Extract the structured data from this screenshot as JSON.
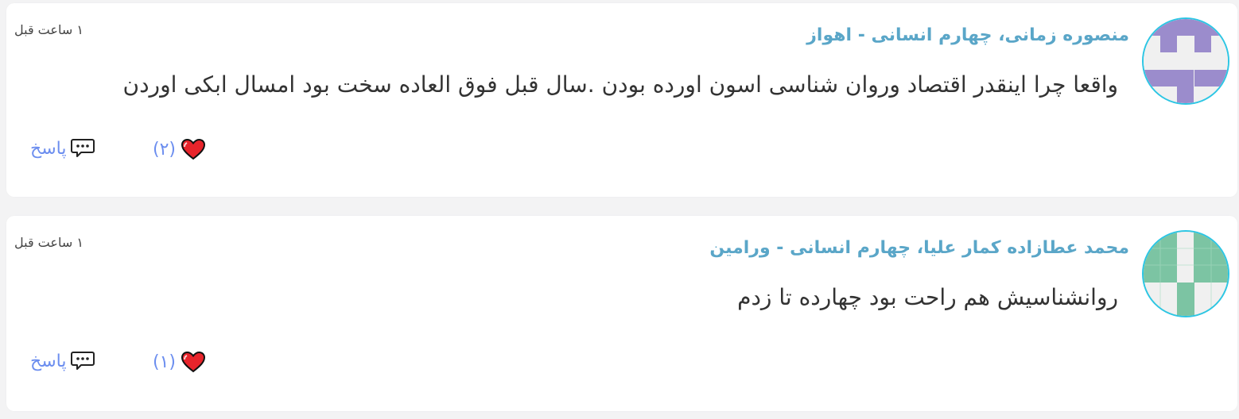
{
  "comments": [
    {
      "author": "منصوره زمانی، چهارم انسانی - اهواز",
      "time": "۱ ساعت قبل",
      "text": "واقعا چرا اینقدر اقتصاد وروان شناسی اسون اورده بودن .سال قبل فوق العاده سخت بود امسال ابکی اوردن",
      "likes": "(۲)",
      "reply_label": "پاسخ",
      "avatar_color": "#9b8ccc"
    },
    {
      "author": "محمد عطازاده کمار علیا، چهارم انسانی - ورامین",
      "time": "۱ ساعت قبل",
      "text": "روانشناسیش هم راحت بود چهارده تا زدم",
      "likes": "(۱)",
      "reply_label": "پاسخ",
      "avatar_color": "#7cc4a3"
    }
  ],
  "icons": {
    "like": "heart-icon",
    "reply": "comment-icon"
  },
  "colors": {
    "author": "#5aa6c8",
    "action": "#6c8eef",
    "avatar_border": "#2cc6e4"
  }
}
